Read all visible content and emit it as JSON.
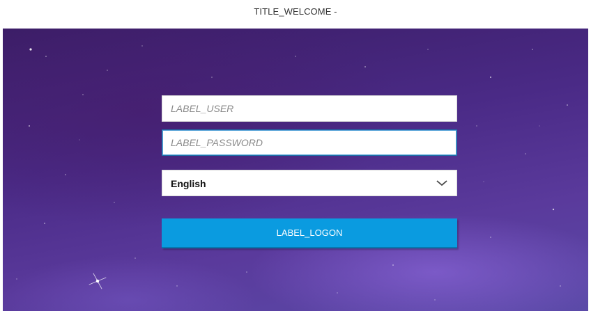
{
  "header": {
    "title": "TITLE_WELCOME -"
  },
  "login": {
    "user_placeholder": "LABEL_USER",
    "password_placeholder": "LABEL_PASSWORD",
    "language": {
      "selected": "English"
    },
    "logon_label": "LABEL_LOGON"
  },
  "colors": {
    "button": "#0a9be0",
    "background_top": "#3b1d66",
    "background_bottom": "#5b4aa8",
    "focus_border": "#1e6fa8"
  },
  "icons": {
    "dropdown": "chevron-down-icon"
  }
}
